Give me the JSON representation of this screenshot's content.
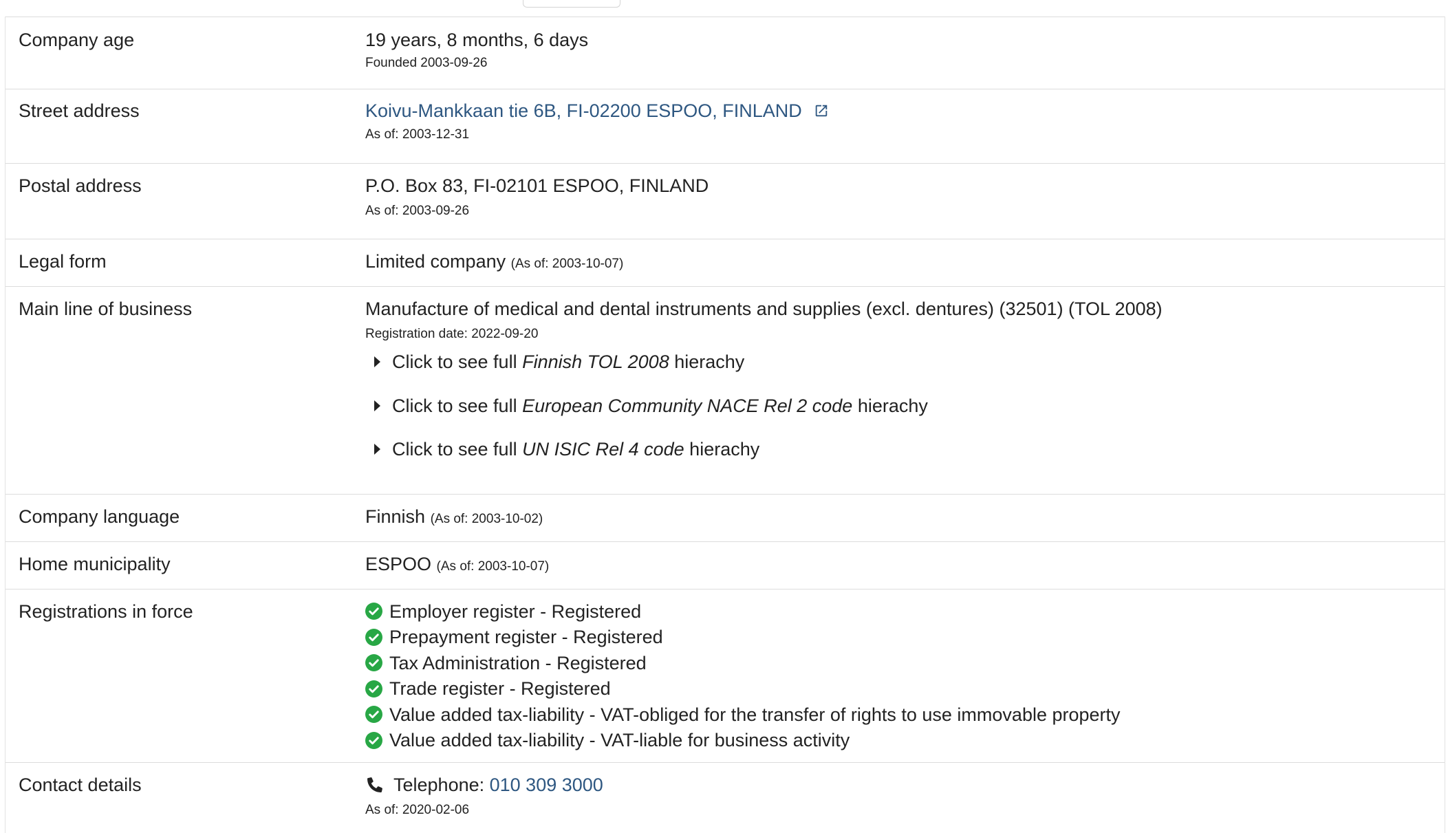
{
  "rows": {
    "company_age": {
      "label": "Company age",
      "value": "19 years, 8 months, 6 days",
      "sub": "Founded 2003-09-26"
    },
    "street_address": {
      "label": "Street address",
      "value": "Koivu-Mankkaan tie 6B, FI-02200 ESPOO, FINLAND",
      "sub": "As of: 2003-12-31"
    },
    "postal_address": {
      "label": "Postal address",
      "value": "P.O. Box 83, FI-02101 ESPOO, FINLAND",
      "sub": "As of: 2003-09-26"
    },
    "legal_form": {
      "label": "Legal form",
      "value": "Limited company",
      "asof": "(As of: 2003-10-07)"
    },
    "main_line": {
      "label": "Main line of business",
      "value": "Manufacture of medical and dental instruments and supplies (excl. dentures) (32501) (TOL 2008)",
      "sub": "Registration date: 2022-09-20",
      "hierarchies": [
        {
          "prefix": "Click to see full ",
          "name": "Finnish TOL 2008",
          "suffix": " hierachy"
        },
        {
          "prefix": "Click to see full ",
          "name": "European Community NACE Rel 2 code",
          "suffix": " hierachy"
        },
        {
          "prefix": "Click to see full ",
          "name": "UN ISIC Rel 4 code",
          "suffix": " hierachy"
        }
      ]
    },
    "company_language": {
      "label": "Company language",
      "value": "Finnish",
      "asof": "(As of: 2003-10-02)"
    },
    "home_municipality": {
      "label": "Home municipality",
      "value": "ESPOO",
      "asof": "(As of: 2003-10-07)"
    },
    "registrations": {
      "label": "Registrations in force",
      "items": [
        "Employer register - Registered",
        "Prepayment register - Registered",
        "Tax Administration - Registered",
        "Trade register - Registered",
        "Value added tax-liability - VAT-obliged for the transfer of rights to use immovable property",
        "Value added tax-liability - VAT-liable for business activity"
      ]
    },
    "contact": {
      "label": "Contact details",
      "phone_label": "Telephone: ",
      "phone": "010 309 3000",
      "sub": "As of: 2020-02-06"
    }
  },
  "icons": {
    "external_link": "external-link-icon",
    "check": "check-circle-icon",
    "phone": "phone-icon",
    "caret": "caret-right-icon"
  },
  "colors": {
    "link": "#2e5781",
    "check": "#28a745",
    "border": "#dcdcdc"
  }
}
